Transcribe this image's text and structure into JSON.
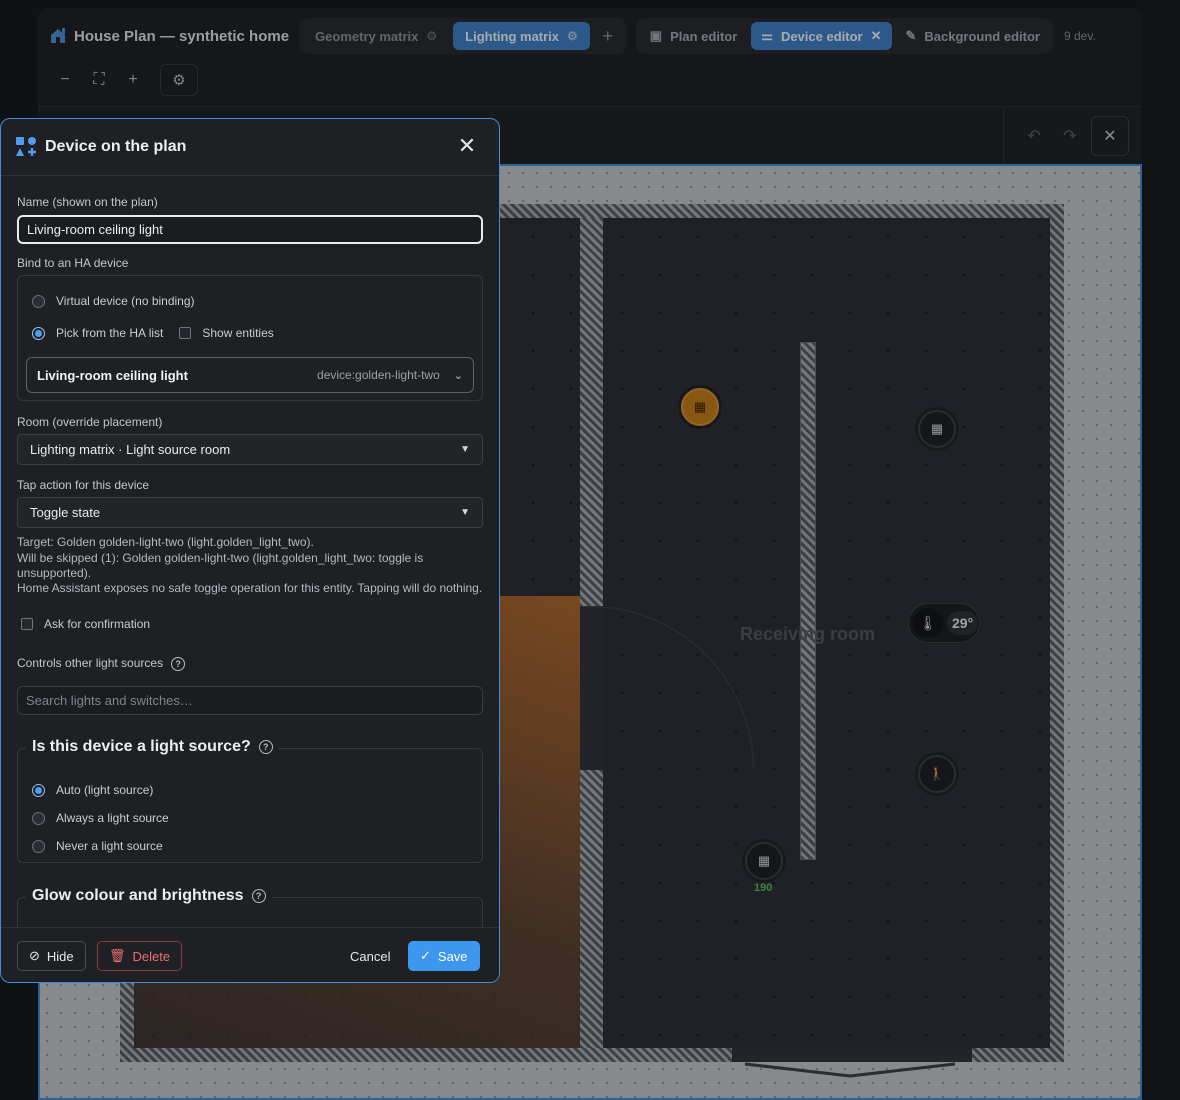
{
  "app": {
    "title": "House Plan — synthetic home",
    "tabs": [
      {
        "label": "Geometry matrix",
        "active": false
      },
      {
        "label": "Lighting matrix",
        "active": true
      }
    ],
    "modes": [
      {
        "label": "Plan editor",
        "active": false
      },
      {
        "label": "Device editor",
        "active": true
      },
      {
        "label": "Background editor",
        "active": false
      }
    ],
    "device_count": "9 dev."
  },
  "plan": {
    "room_label": "Receiving room",
    "temperature": "29°",
    "lux_value": "190"
  },
  "dialog": {
    "title": "Device on the plan",
    "name_label": "Name (shown on the plan)",
    "name_value": "Living-room ceiling light",
    "bind_label": "Bind to an HA device",
    "bind_options": {
      "virtual": "Virtual device (no binding)",
      "pick": "Pick from the HA list",
      "selected": "pick"
    },
    "show_entities": "Show entities",
    "device_select": {
      "name": "Living-room ceiling light",
      "id": "device:golden-light-two"
    },
    "room_label": "Room (override placement)",
    "room_value": "Lighting matrix · Light source room",
    "tap_label": "Tap action for this device",
    "tap_value": "Toggle state",
    "notes": {
      "target": "Target: Golden golden-light-two (light.golden_light_two).",
      "skipped": "Will be skipped (1): Golden golden-light-two (light.golden_light_two: toggle is unsupported).",
      "warning": "Home Assistant exposes no safe toggle operation for this entity. Tapping will do nothing."
    },
    "ask_confirmation": "Ask for confirmation",
    "controls_label": "Controls other light sources",
    "search_placeholder": "Search lights and switches…",
    "light_source": {
      "legend": "Is this device a light source?",
      "options": [
        "Auto (light source)",
        "Always a light source",
        "Never a light source"
      ],
      "selected": "Auto (light source)"
    },
    "glow_legend": "Glow colour and brightness",
    "footer": {
      "hide": "Hide",
      "delete": "Delete",
      "cancel": "Cancel",
      "save": "Save"
    }
  },
  "colors": {
    "accent": "#3d97ee",
    "light_on": "#c47c14",
    "danger": "#ef6e6e",
    "lux": "#4fbf5a"
  },
  "icons": {
    "brand": "house-icon",
    "dialog": "shapes-icon",
    "lamp": "lamp-icon",
    "thermometer": "thermometer-icon",
    "motion": "walking-person-icon"
  }
}
